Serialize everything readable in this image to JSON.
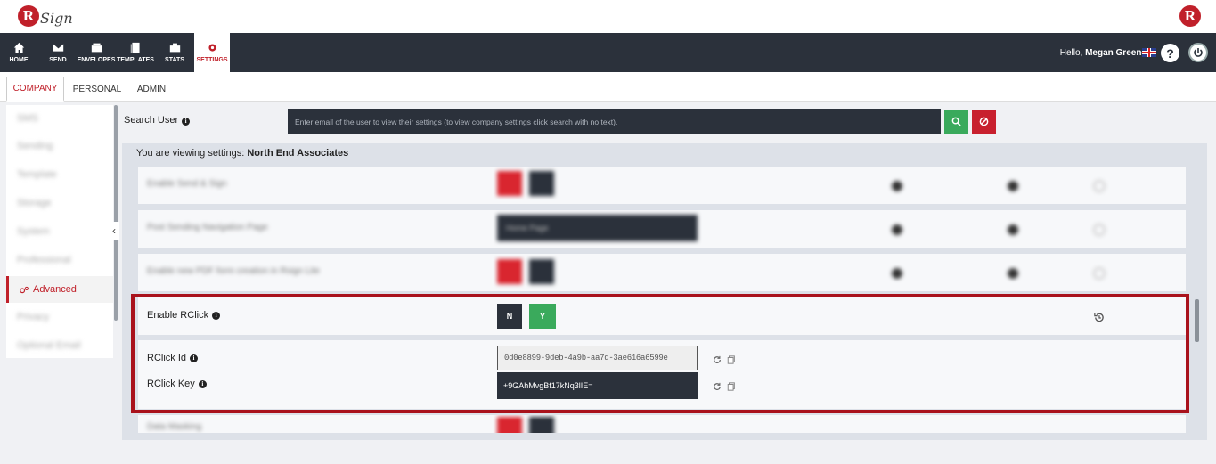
{
  "app": {
    "logo_text": "Sign",
    "logo_letter": "R"
  },
  "nav": {
    "items": [
      {
        "label": "HOME"
      },
      {
        "label": "SEND"
      },
      {
        "label": "ENVELOPES"
      },
      {
        "label": "TEMPLATES"
      },
      {
        "label": "STATS"
      },
      {
        "label": "SETTINGS",
        "active": true
      }
    ],
    "greeting": "Hello,",
    "user_name": "Megan Greene",
    "help_symbol": "?"
  },
  "tabs": [
    {
      "label": "COMPANY",
      "active": true
    },
    {
      "label": "PERSONAL"
    },
    {
      "label": "ADMIN"
    }
  ],
  "sidebar": {
    "items": [
      {
        "label": "SMS"
      },
      {
        "label": "Sending"
      },
      {
        "label": "Template"
      },
      {
        "label": "Storage"
      },
      {
        "label": "System"
      },
      {
        "label": "Professional"
      },
      {
        "label": "Advanced",
        "active": true
      },
      {
        "label": "Privacy"
      },
      {
        "label": "Optional Email"
      }
    ],
    "collapse_symbol": "‹"
  },
  "search": {
    "label": "Search User",
    "placeholder": "Enter email of the user to view their settings (to view company settings click search with no text)."
  },
  "viewing": {
    "prefix": "You are viewing settings:",
    "company": "North End Associates"
  },
  "blurred_rows": [
    {
      "label": "Enable Send & Sign"
    },
    {
      "label": "Post Sending Navigation Page",
      "select": "Home Page"
    },
    {
      "label": "Enable new PDF form creation in Rsign Lite"
    },
    {
      "label": "Data Masking"
    }
  ],
  "rclick": {
    "enable_label": "Enable RClick",
    "n_label": "N",
    "y_label": "Y",
    "id_label": "RClick Id",
    "id_value": "0d0e8899-9deb-4a9b-aa7d-3ae616a6599e",
    "key_label": "RClick Key",
    "key_value": "+9GAhMvgBf17kNq3lIE="
  },
  "colors": {
    "brand_red": "#c0202a",
    "navbar": "#2b313b",
    "success": "#3aaa5c",
    "highlight_border": "#a9121c"
  }
}
